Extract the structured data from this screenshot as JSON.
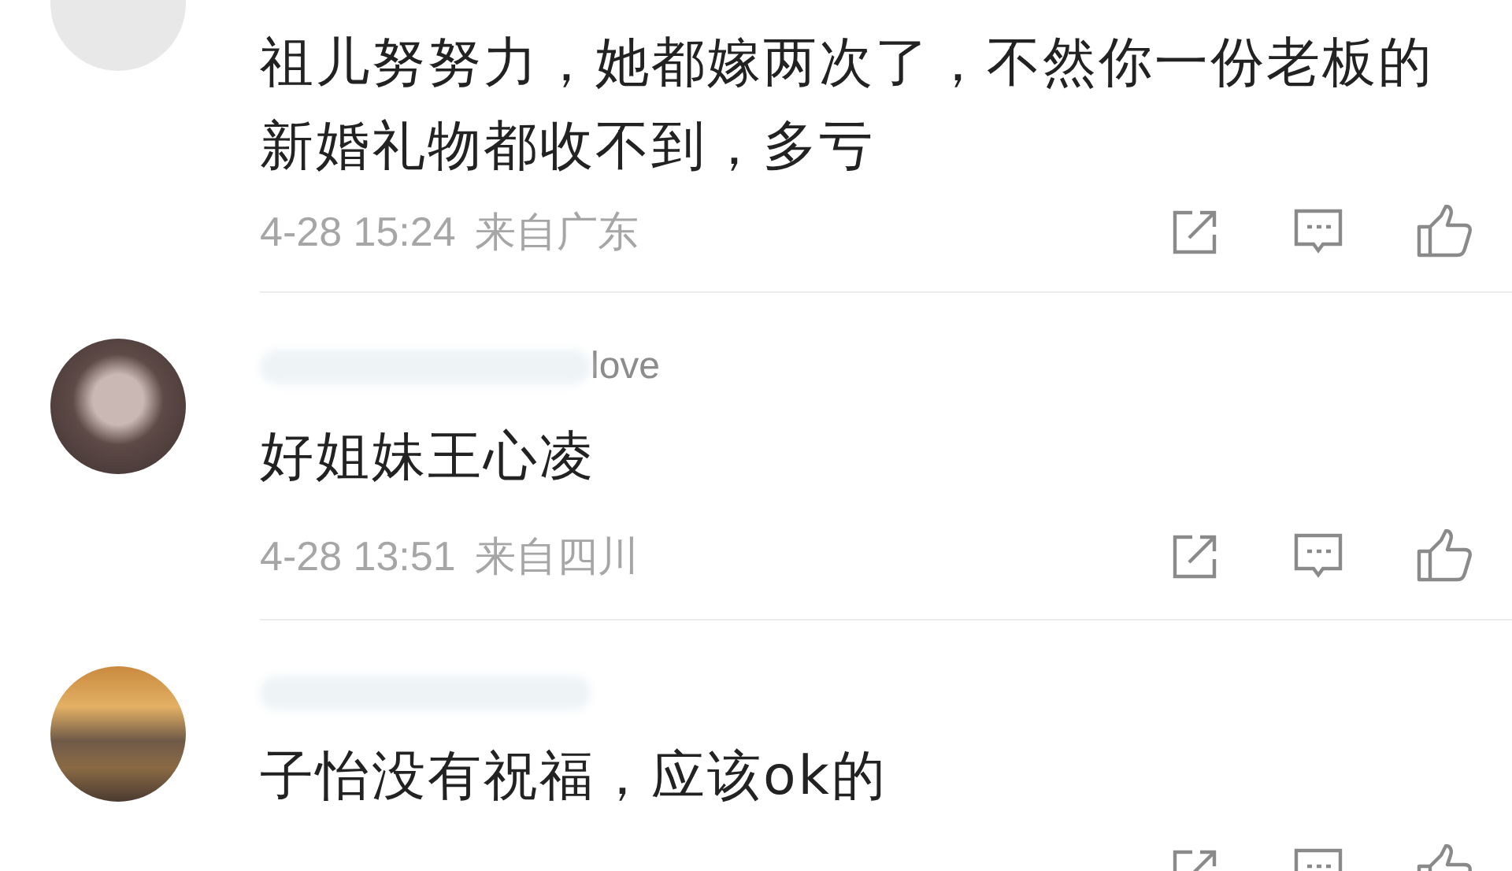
{
  "comments": [
    {
      "avatar": {
        "kind": "blank"
      },
      "text": "祖儿努努力，她都嫁两次了，不然你一份老板的新婚礼物都收不到，多亏",
      "time": "4-28 15:24",
      "location": "来自广东"
    },
    {
      "avatar": {
        "kind": "portrait"
      },
      "username": "love",
      "text": "好姐妹王心凌",
      "time": "4-28 13:51",
      "location": "来自四川"
    },
    {
      "avatar": {
        "kind": "landscape"
      },
      "text": "子怡没有祝福，应该ok的"
    }
  ]
}
